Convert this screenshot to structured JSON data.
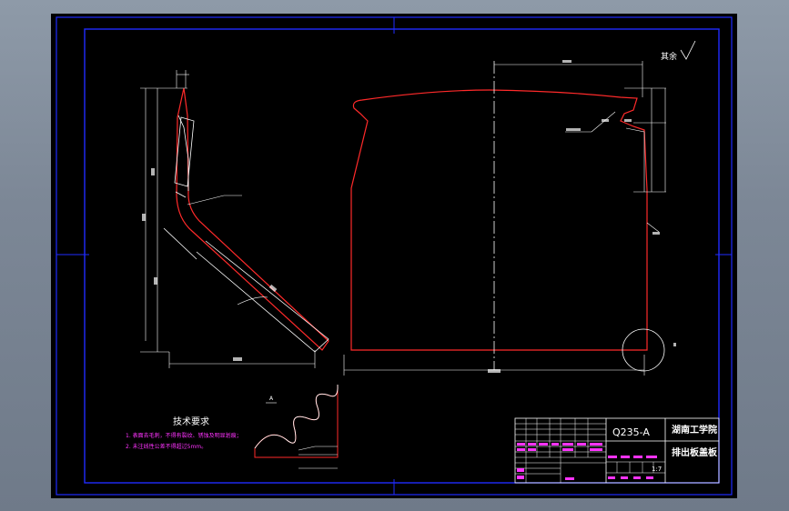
{
  "title_block": {
    "material": "Q235-A",
    "school": "湖南工学院",
    "part_name": "排出板盖板",
    "scale": "1:7"
  },
  "tech_req": {
    "heading": "技术要求",
    "line1": "1. 表面去毛刺，不得有裂纹、锈蚀及明显划痕；",
    "line2": "2. 未注线性公差不得超过5mm。"
  },
  "surface_finish_note": "其余",
  "colors": {
    "frame": "#1f2bff",
    "outline": "#ff2a2a",
    "dimension": "#ffffff",
    "title_text": "#ff33ff"
  }
}
